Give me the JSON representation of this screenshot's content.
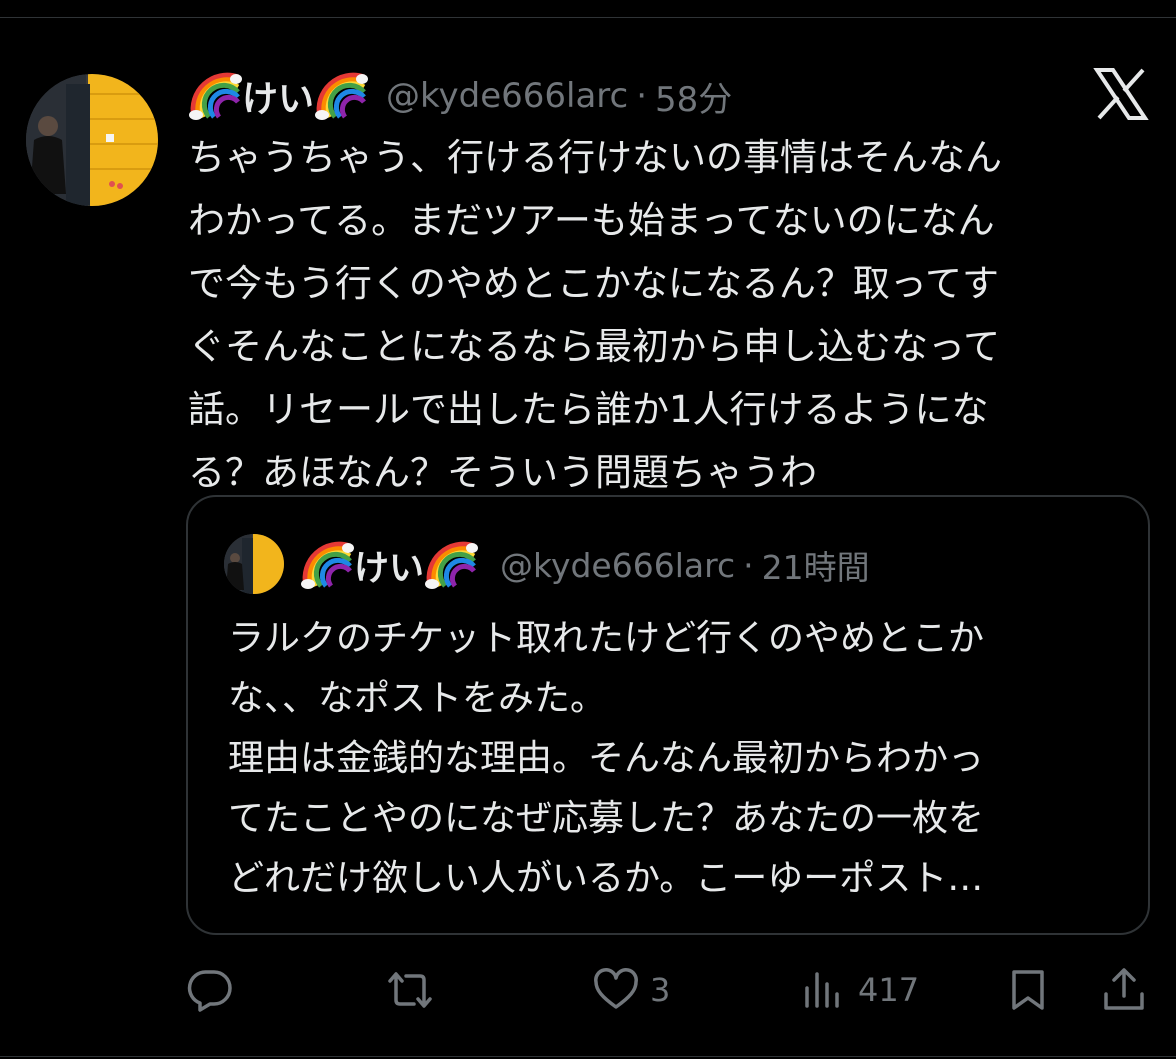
{
  "tweet": {
    "display_name": "けい",
    "handle": "@kyde666larc",
    "separator": "·",
    "time": "58分",
    "text": "ちゃうちゃう、行ける行けないの事情はそんなん\nわかってる。まだツアーも始まってないのになん\nで今もう行くのやめとこかなになるん？取ってす\nぐそんなことになるなら最初から申し込むなって\n話。リセールで出したら誰か1人行けるようにな\nる？あほなん？そういう問題ちゃうわ"
  },
  "quoted_tweet": {
    "display_name": "けい",
    "handle": "@kyde666larc",
    "separator": "·",
    "time": "21時間",
    "text": "ラルクのチケット取れたけど行くのやめとこか\nな、、なポストをみた。\n理由は金銭的な理由。そんなん最初からわかっ\nてたことやのになぜ応募した？あなたの一枚を\nどれだけ欲しい人がいるか。こーゆーポスト…"
  },
  "actions": {
    "reply": {
      "icon": "reply-icon"
    },
    "repost": {
      "icon": "repost-icon"
    },
    "like": {
      "icon": "heart-icon",
      "count": "3"
    },
    "views": {
      "icon": "views-icon",
      "count": "417"
    },
    "bookmark": {
      "icon": "bookmark-icon"
    },
    "share": {
      "icon": "share-icon"
    }
  },
  "colors": {
    "background": "#000000",
    "text": "#e7e9ea",
    "secondary": "#71767b",
    "border": "#2f3336"
  }
}
